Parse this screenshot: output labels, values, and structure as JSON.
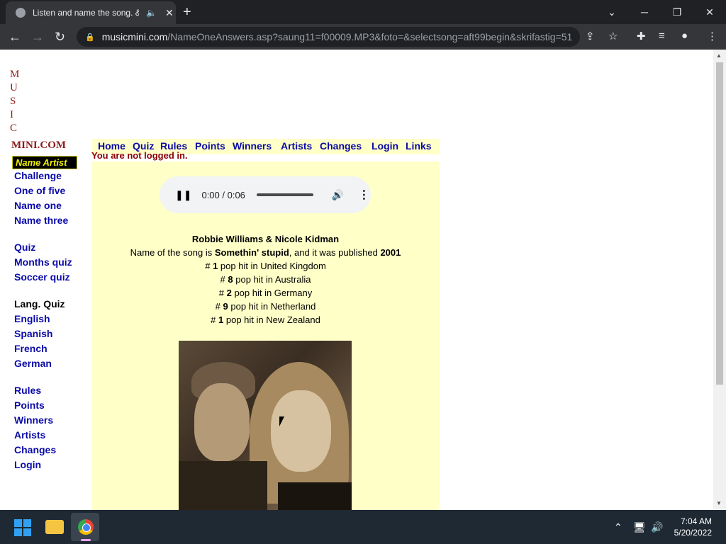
{
  "browser": {
    "tab_title": "Listen and name the song. &",
    "url_host": "musicmini.com",
    "url_path": "/NameOneAnswers.asp?saung11=f00009.MP3&foto=&selectsong=aft99begin&skrifastig=51"
  },
  "logo": {
    "letters": [
      "M",
      "U",
      "S",
      "I",
      "C"
    ],
    "word": "MINI.COM",
    "badge": "Name Artist"
  },
  "left_menu": {
    "group1": [
      "Challenge",
      "One of five",
      "Name one",
      "Name three"
    ],
    "group2": [
      "Quiz",
      "Months quiz",
      "Soccer quiz"
    ],
    "lang_heading": "Lang. Quiz",
    "group3": [
      "English",
      "Spanish",
      "French",
      "German"
    ],
    "group4": [
      "Rules",
      "Points",
      "Winners",
      "Artists",
      "Changes",
      "Login"
    ]
  },
  "top_nav": [
    "Home",
    "Quiz",
    "Rules",
    "Points",
    "Winners",
    "Artists",
    "Changes",
    "Login",
    "Links"
  ],
  "status": "You are not logged in.",
  "audio": {
    "time": "0:00 / 0:06"
  },
  "song": {
    "artist": "Robbie Williams & Nicole Kidman",
    "line_prefix": "Name of the song is",
    "title": "Somethin' stupid",
    "line_mid": ", and it was published",
    "year": "2001",
    "charts": [
      {
        "hash": "#",
        "pos": "1",
        "text": "pop hit in United Kingdom"
      },
      {
        "hash": "#",
        "pos": "8",
        "text": "pop hit in Australia"
      },
      {
        "hash": "#",
        "pos": "2",
        "text": "pop hit in Germany"
      },
      {
        "hash": "#",
        "pos": "9",
        "text": "pop hit in Netherland"
      },
      {
        "hash": "#",
        "pos": "1",
        "text": "pop hit in New Zealand"
      }
    ]
  },
  "taskbar": {
    "time": "7:04 AM",
    "date": "5/20/2022"
  }
}
